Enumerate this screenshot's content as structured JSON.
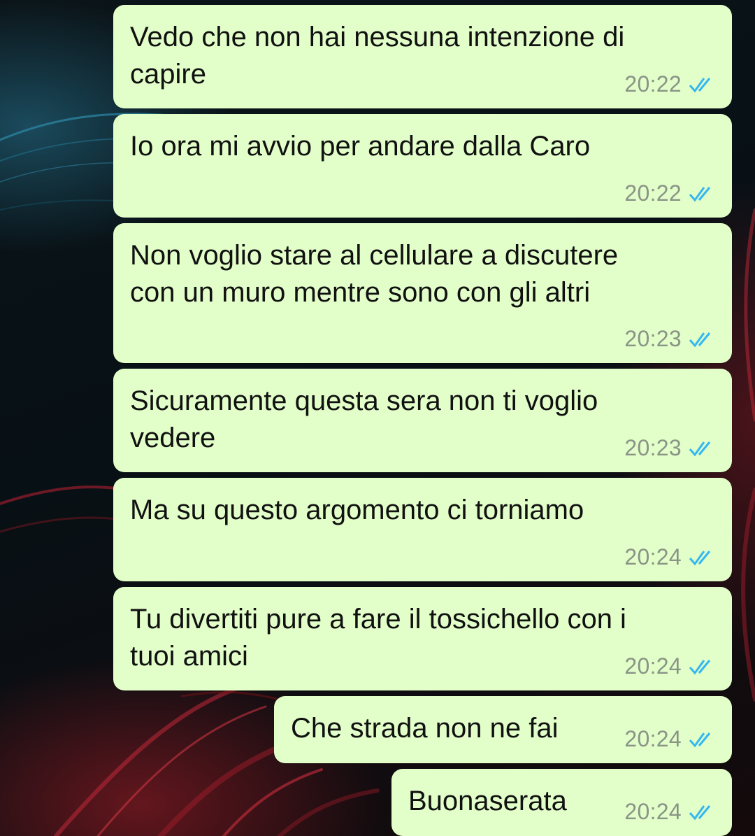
{
  "colors": {
    "bubble": "#e2fec9",
    "read_ticks": "#34b7f1",
    "time": "#8a9486",
    "text": "#111111"
  },
  "messages": [
    {
      "text": "Vedo che non hai nessuna intenzione di\ncapire",
      "time": "20:22",
      "status_icon": "double-check-read-icon"
    },
    {
      "text": "Io ora mi avvio per andare dalla Caro",
      "time": "20:22",
      "status_icon": "double-check-read-icon"
    },
    {
      "text": "Non voglio stare al cellulare a discutere\ncon un muro mentre sono con gli altri",
      "time": "20:23",
      "status_icon": "double-check-read-icon"
    },
    {
      "text": "Sicuramente questa sera non ti voglio\nvedere",
      "time": "20:23",
      "status_icon": "double-check-read-icon"
    },
    {
      "text": "Ma su questo argomento ci torniamo",
      "time": "20:24",
      "status_icon": "double-check-read-icon"
    },
    {
      "text": "Tu divertiti pure a fare il tossichello con i\ntuoi amici",
      "time": "20:24",
      "status_icon": "double-check-read-icon"
    },
    {
      "text": "Che strada non ne fai",
      "time": "20:24",
      "status_icon": "double-check-read-icon"
    },
    {
      "text": "Buonaserata",
      "time": "20:24",
      "status_icon": "double-check-read-icon"
    }
  ]
}
